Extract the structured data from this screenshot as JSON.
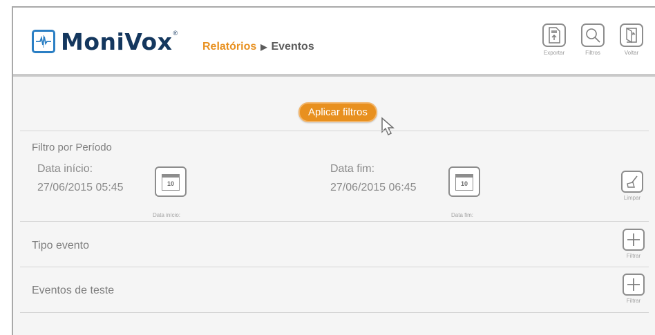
{
  "app": {
    "name": "MoniVox",
    "reg": "®"
  },
  "breadcrumb": {
    "parent": "Relatórios",
    "separator": "▶",
    "current": "Eventos"
  },
  "toolbar": {
    "export_label": "Exportar",
    "filters_label": "Filtros",
    "back_label": "Voltar"
  },
  "apply_button": {
    "label": "Aplicar filtros"
  },
  "period_filter": {
    "title": "Filtro por Período",
    "start_label": "Data início:",
    "start_value": "27/06/2015 05:45",
    "start_calendar_day": "10",
    "start_calendar_caption": "Data início:",
    "end_label": "Data fim:",
    "end_value": "27/06/2015 06:45",
    "end_calendar_day": "10",
    "end_calendar_caption": "Data fim:",
    "clear_label": "Limpar"
  },
  "event_type": {
    "title": "Tipo evento",
    "filter_label": "Filtrar"
  },
  "test_events": {
    "title": "Eventos de teste",
    "filter_label": "Filtrar"
  },
  "colors": {
    "accent": "#e8901f",
    "brand": "#14375e",
    "logo_blue": "#2b7fc4"
  }
}
